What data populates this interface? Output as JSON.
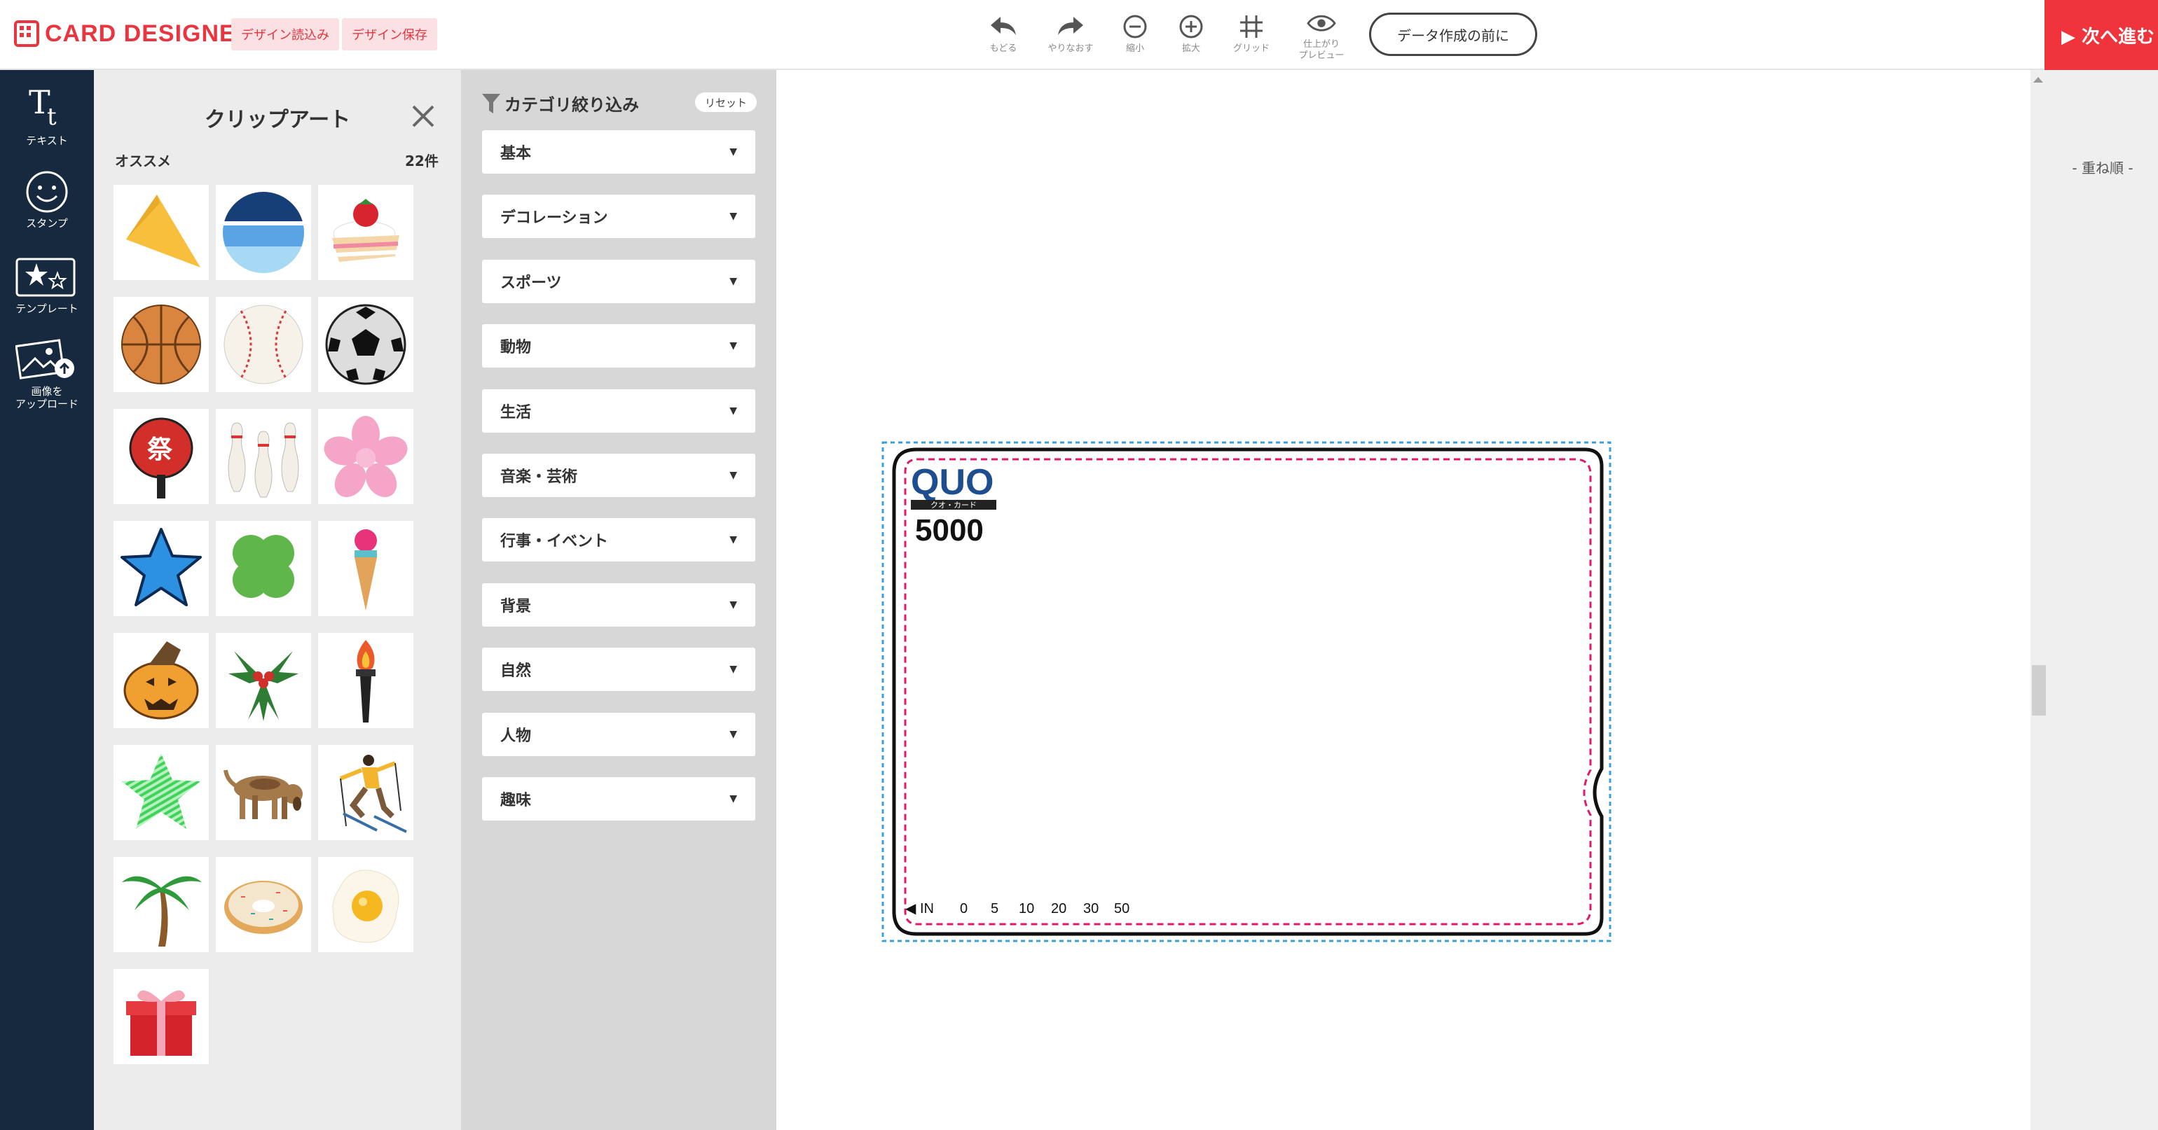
{
  "header": {
    "logo_text": "CARD DESIGNER",
    "load_label": "デザイン読込み",
    "save_label": "デザイン保存",
    "tools": [
      {
        "label": "もどる",
        "icon": "undo-icon"
      },
      {
        "label": "やりなおす",
        "icon": "redo-icon"
      },
      {
        "label": "縮小",
        "icon": "zoom-out-icon"
      },
      {
        "label": "拡大",
        "icon": "zoom-in-icon"
      },
      {
        "label": "グリッド",
        "icon": "grid-icon"
      },
      {
        "label": "仕上がり\nプレビュー",
        "icon": "eye-icon"
      }
    ],
    "before_data_label": "データ作成の前に",
    "next_label": "▶ 次へ進む"
  },
  "leftnav": {
    "items": [
      {
        "label": "テキスト",
        "icon": "text-icon"
      },
      {
        "label": "スタンプ",
        "icon": "smiley-icon"
      },
      {
        "label": "テンプレート",
        "icon": "template-icon"
      },
      {
        "label": "画像を\nアップロード",
        "icon": "upload-image-icon"
      }
    ]
  },
  "clip": {
    "title": "クリップアート",
    "section": "オススメ",
    "count": "22件",
    "items": [
      "pennant-icon",
      "circle-blue-icon",
      "strawberry-cake-icon",
      "basketball-icon",
      "baseball-icon",
      "soccer-ball-icon",
      "festival-fan-icon",
      "bowling-pins-icon",
      "sakura-icon",
      "blue-star-icon",
      "clover-icon",
      "ice-cream-icon",
      "pumpkin-icon",
      "holly-icon",
      "torch-icon",
      "striped-star-icon",
      "dog-icon",
      "skier-icon",
      "palm-tree-icon",
      "donut-icon",
      "fried-egg-icon",
      "gift-box-icon"
    ]
  },
  "categories": {
    "title": "カテゴリ絞り込み",
    "reset_label": "リセット",
    "items": [
      "基本",
      "デコレーション",
      "スポーツ",
      "動物",
      "生活",
      "音楽・芸術",
      "行事・イベント",
      "背景",
      "自然",
      "人物",
      "趣味"
    ]
  },
  "card": {
    "brand": "QUO",
    "brand_sub": "クオ・カード",
    "value": "5000",
    "scale_in": "◀ IN",
    "scale_marks": [
      "0",
      "5",
      "10",
      "20",
      "30",
      "50"
    ]
  },
  "layers": {
    "title": "- 重ね順 -"
  },
  "colors": {
    "accent": "#e8353f",
    "nav_bg": "#16293e",
    "quo_blue": "#1d4e8f"
  }
}
